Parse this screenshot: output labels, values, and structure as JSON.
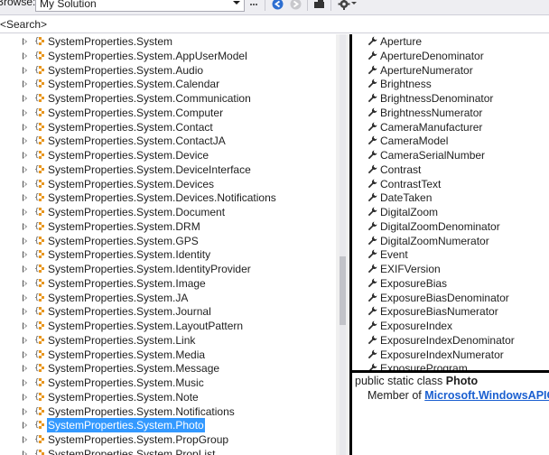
{
  "toolbar": {
    "browse_label": "Browse:",
    "browse_value": "My Solution"
  },
  "search": {
    "value": "<Search>"
  },
  "tree": {
    "items": [
      {
        "label": "SystemProperties.System",
        "selected": false
      },
      {
        "label": "SystemProperties.System.AppUserModel",
        "selected": false
      },
      {
        "label": "SystemProperties.System.Audio",
        "selected": false
      },
      {
        "label": "SystemProperties.System.Calendar",
        "selected": false
      },
      {
        "label": "SystemProperties.System.Communication",
        "selected": false
      },
      {
        "label": "SystemProperties.System.Computer",
        "selected": false
      },
      {
        "label": "SystemProperties.System.Contact",
        "selected": false
      },
      {
        "label": "SystemProperties.System.ContactJA",
        "selected": false
      },
      {
        "label": "SystemProperties.System.Device",
        "selected": false
      },
      {
        "label": "SystemProperties.System.DeviceInterface",
        "selected": false
      },
      {
        "label": "SystemProperties.System.Devices",
        "selected": false
      },
      {
        "label": "SystemProperties.System.Devices.Notifications",
        "selected": false
      },
      {
        "label": "SystemProperties.System.Document",
        "selected": false
      },
      {
        "label": "SystemProperties.System.DRM",
        "selected": false
      },
      {
        "label": "SystemProperties.System.GPS",
        "selected": false
      },
      {
        "label": "SystemProperties.System.Identity",
        "selected": false
      },
      {
        "label": "SystemProperties.System.IdentityProvider",
        "selected": false
      },
      {
        "label": "SystemProperties.System.Image",
        "selected": false
      },
      {
        "label": "SystemProperties.System.JA",
        "selected": false
      },
      {
        "label": "SystemProperties.System.Journal",
        "selected": false
      },
      {
        "label": "SystemProperties.System.LayoutPattern",
        "selected": false
      },
      {
        "label": "SystemProperties.System.Link",
        "selected": false
      },
      {
        "label": "SystemProperties.System.Media",
        "selected": false
      },
      {
        "label": "SystemProperties.System.Message",
        "selected": false
      },
      {
        "label": "SystemProperties.System.Music",
        "selected": false
      },
      {
        "label": "SystemProperties.System.Note",
        "selected": false
      },
      {
        "label": "SystemProperties.System.Notifications",
        "selected": false
      },
      {
        "label": "SystemProperties.System.Photo",
        "selected": true
      },
      {
        "label": "SystemProperties.System.PropGroup",
        "selected": false
      },
      {
        "label": "SystemProperties.System.PropList",
        "selected": false
      }
    ]
  },
  "members": {
    "items": [
      "Aperture",
      "ApertureDenominator",
      "ApertureNumerator",
      "Brightness",
      "BrightnessDenominator",
      "BrightnessNumerator",
      "CameraManufacturer",
      "CameraModel",
      "CameraSerialNumber",
      "Contrast",
      "ContrastText",
      "DateTaken",
      "DigitalZoom",
      "DigitalZoomDenominator",
      "DigitalZoomNumerator",
      "Event",
      "EXIFVersion",
      "ExposureBias",
      "ExposureBiasDenominator",
      "ExposureBiasNumerator",
      "ExposureIndex",
      "ExposureIndexDenominator",
      "ExposureIndexNumerator",
      "ExposureProgram"
    ]
  },
  "description": {
    "prefix": "public static class ",
    "class_name": "Photo",
    "member_of": "Member of ",
    "namespace_link": "Microsoft.WindowsAPICodePack.Shell.PropertySystem.SystemProperties.System"
  },
  "colors": {
    "selection": "#3399ff",
    "link": "#1a5fd0",
    "namespace_icon": "#e8961e"
  }
}
